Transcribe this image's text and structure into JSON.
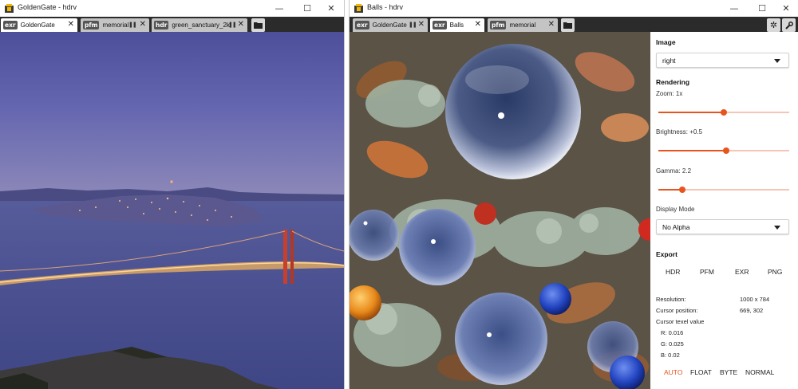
{
  "left_window": {
    "title": "GoldenGate - hdrv",
    "tabs": [
      {
        "badge": "exr",
        "label": "GoldenGate",
        "active": true
      },
      {
        "badge": "pfm",
        "label": "memorial",
        "active": false
      },
      {
        "badge": "hdr",
        "label": "green_sanctuary_2k",
        "active": false
      }
    ],
    "image": "golden-gate-bridge-at-dusk"
  },
  "right_window": {
    "title": "Balls - hdrv",
    "tabs": [
      {
        "badge": "exr",
        "label": "GoldenGate",
        "active": false
      },
      {
        "badge": "exr",
        "label": "Balls",
        "active": true
      },
      {
        "badge": "pfm",
        "label": "memorial",
        "active": false
      }
    ],
    "image": "glass-balls-on-lichen"
  },
  "window_controls": {
    "minimize": "—",
    "maximize": "☐",
    "close": "✕"
  },
  "icons": {
    "folder": "folder-icon",
    "settings": "gear-icon",
    "wrench": "wrench-icon"
  },
  "panel": {
    "image_heading": "Image",
    "image_select": "right",
    "rendering_heading": "Rendering",
    "zoom_label": "Zoom: 1x",
    "zoom_level": 0.5,
    "brightness_label": "Brightness: +0.5",
    "brightness_level": 0.52,
    "gamma_label": "Gamma: 2.2",
    "gamma_level": 0.18,
    "display_mode_label": "Display Mode",
    "display_mode_value": "No Alpha",
    "export_heading": "Export",
    "export_buttons": [
      "HDR",
      "PFM",
      "EXR",
      "PNG"
    ],
    "resolution_label": "Resolution:",
    "resolution_value": "1000 x 784",
    "cursor_position_label": "Cursor position:",
    "cursor_position_value": "669, 302",
    "texel_label": "Cursor texel value",
    "r_value": "R: 0.016",
    "g_value": "G: 0.025",
    "b_value": "B: 0.02",
    "modes": [
      "AUTO",
      "FLOAT",
      "BYTE",
      "NORMAL"
    ],
    "active_mode": "AUTO"
  },
  "colors": {
    "accent": "#e8541e",
    "tabbar": "#2b2b2b",
    "tab_inactive": "#c4c4c4"
  }
}
